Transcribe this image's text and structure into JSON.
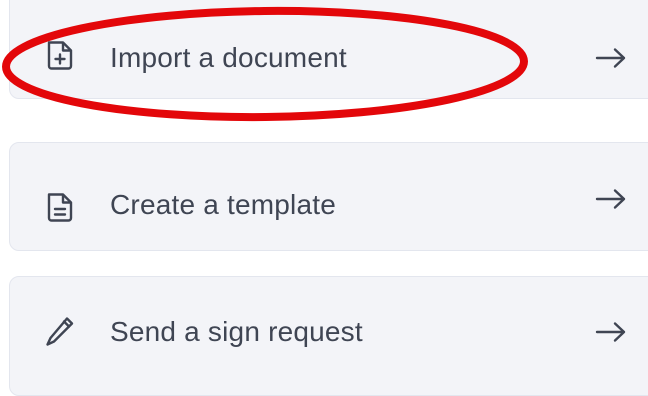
{
  "actions": [
    {
      "label": "Import a document",
      "icon": "file-plus-icon",
      "trailing_icon": "arrow-right-icon"
    },
    {
      "label": "Create a template",
      "icon": "file-text-icon",
      "trailing_icon": "arrow-right-icon"
    },
    {
      "label": "Send a sign request",
      "icon": "pencil-icon",
      "trailing_icon": "arrow-right-icon"
    }
  ],
  "highlight": {
    "target": "Import a document",
    "color": "#e3070a"
  },
  "colors": {
    "card_background": "#f3f4f8",
    "card_border": "#e3e6ee",
    "text": "#3f4553",
    "icon": "#3f4553"
  }
}
